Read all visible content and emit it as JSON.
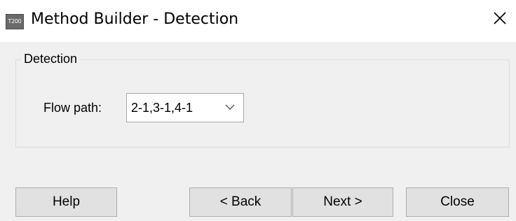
{
  "window": {
    "icon_text": "T200",
    "icon": "app-icon",
    "title": "Method Builder - Detection",
    "close_icon": "close-icon"
  },
  "group": {
    "legend": "Detection",
    "flow_path": {
      "label": "Flow path:",
      "selected_value": "2-1,3-1,4-1",
      "dropdown_icon": "chevron-down-icon"
    }
  },
  "buttons": {
    "help": "Help",
    "back": "< Back",
    "next": "Next >",
    "close": "Close"
  },
  "colors": {
    "client_background": "#f0f0f0",
    "button_face": "#e1e1e1",
    "button_border": "#adadad",
    "group_border": "#dcdcdc"
  }
}
